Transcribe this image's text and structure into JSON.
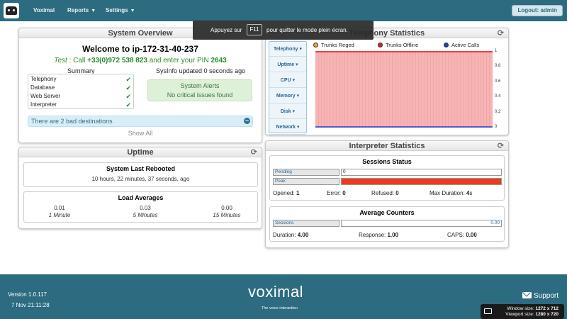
{
  "nav": {
    "brand": "Voximal",
    "items": [
      {
        "label": "Reports",
        "caret": "▼"
      },
      {
        "label": "Settings",
        "caret": "▼"
      }
    ],
    "logout": "Logout: admin"
  },
  "toast": {
    "before": "Appuyez sur",
    "key": "F11",
    "after": "pour quitter le mode plein écran."
  },
  "system_overview": {
    "title": "System Overview",
    "welcome": "Welcome to ip-172-31-40-237",
    "test_prefix": "Test",
    "test_call": ": Call",
    "phone": "+33(0)972 538 823",
    "pin_text": "and enter your PIN",
    "pin": "2643",
    "summary_title": "Summary",
    "sysinfo": "SysInfo updated 0 seconds ago",
    "summary_items": [
      "Telephony",
      "Database",
      "Web Server",
      "Interpreter"
    ],
    "alerts_title": "System Alerts",
    "alerts_text": "No critical issues found",
    "bad_destinations": "There are 2 bad destinations",
    "show_all": "Show All"
  },
  "uptime": {
    "title": "Uptime",
    "last_rebooted_title": "System Last Rebooted",
    "last_rebooted_value": "10 hours, 22 minutes, 37 seconds, ago",
    "load_title": "Load Averages",
    "loads": [
      {
        "value": "0.01",
        "label": "1 Minute"
      },
      {
        "value": "0.03",
        "label": "5 Minutes"
      },
      {
        "value": "0.00",
        "label": "15 Minutes"
      }
    ]
  },
  "telephony": {
    "title": "Telephony Statistics",
    "menu": [
      "Telephony ▾",
      "Uptime ▾",
      "CPU ▾",
      "Memory ▾",
      "Disk ▾",
      "Network ▾"
    ],
    "colors": {
      "trunks_reged": "#f5a623",
      "trunks_offline": "#e02020",
      "active_calls": "#1f3fd0",
      "plot_fill": "#f7b4b4"
    }
  },
  "chart_data": {
    "type": "area",
    "series": [
      {
        "name": "Trunks Reged",
        "color": "#f5a623"
      },
      {
        "name": "Trunks Offline",
        "color": "#e02020"
      },
      {
        "name": "Active Calls",
        "color": "#1f3fd0"
      }
    ],
    "y_ticks": [
      "1",
      "0.8",
      "0.6",
      "0.4",
      "0.2",
      "0"
    ],
    "ylim": [
      0,
      1
    ],
    "grid": true,
    "legend": "top"
  },
  "interpreter": {
    "title": "Interpreter Statistics",
    "session_title": "Sessions Status",
    "pending_label": "Pending",
    "pending_value": "0",
    "peak_label": "Peak",
    "opened_label": "Opened:",
    "opened": "1",
    "error_label": "Error:",
    "error": "0",
    "refused_label": "Refused:",
    "refused": "0",
    "maxdur_label": "Max Duration:",
    "maxdur_value": "4",
    "maxdur_unit": "s",
    "avg_title": "Average Counters",
    "sessions_label": "Sessions",
    "sessions_value": "0.00",
    "duration_label": "Duration:",
    "duration": "4.00",
    "response_label": "Response:",
    "response": "1.00",
    "caps_label": "CAPS:",
    "caps": "0.00"
  },
  "footer": {
    "version": "Version 1.0.117",
    "datetime": "7 Nov 21:11:28",
    "brand": "voximal",
    "tagline": "The voice interaction",
    "support": "Support"
  },
  "winsize": {
    "window_label": "Window size:",
    "window_value": "1272 x 712",
    "viewport_label": "Viewport size:",
    "viewport_value": "1280 x 720"
  }
}
